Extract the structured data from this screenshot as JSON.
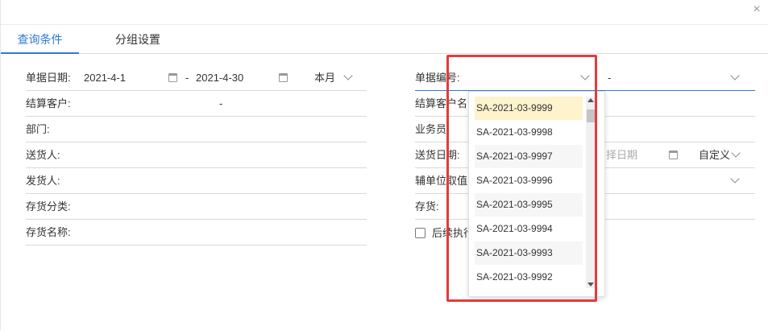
{
  "dialog": {
    "close_symbol": "×"
  },
  "tabs": [
    {
      "label": "查询条件",
      "active": true
    },
    {
      "label": "分组设置",
      "active": false
    }
  ],
  "left_fields": {
    "date": {
      "label": "单据日期:",
      "from": "2021-4-1",
      "separator": "-",
      "to": "2021-4-30",
      "period": "本月"
    },
    "customer": {
      "label": "结算客户:",
      "separator": "-"
    },
    "department": {
      "label": "部门:"
    },
    "delivery_person": {
      "label": "送货人:"
    },
    "shipper": {
      "label": "发货人:"
    },
    "inventory_category": {
      "label": "存货分类:"
    },
    "inventory_name": {
      "label": "存货名称:"
    }
  },
  "right_fields": {
    "doc_number": {
      "label": "单据编号:",
      "separator": "-"
    },
    "customer_name": {
      "label": "结算客户名"
    },
    "salesman": {
      "label": "业务员"
    },
    "delivery_date": {
      "label": "送货日期:",
      "placeholder_partial": "择日期",
      "period": "自定义"
    },
    "aux_unit": {
      "label": "辅单位取值"
    },
    "inventory": {
      "label": "存货:"
    },
    "follow_up": {
      "label": "后续执行"
    }
  },
  "dropdown": {
    "options": [
      "SA-2021-03-9999",
      "SA-2021-03-9998",
      "SA-2021-03-9997",
      "SA-2021-03-9996",
      "SA-2021-03-9995",
      "SA-2021-03-9994",
      "SA-2021-03-9993",
      "SA-2021-03-9992"
    ]
  },
  "colors": {
    "accent": "#2e7ad6",
    "highlight": "#fdf3cc",
    "annotation_box": "#e53a3a"
  }
}
